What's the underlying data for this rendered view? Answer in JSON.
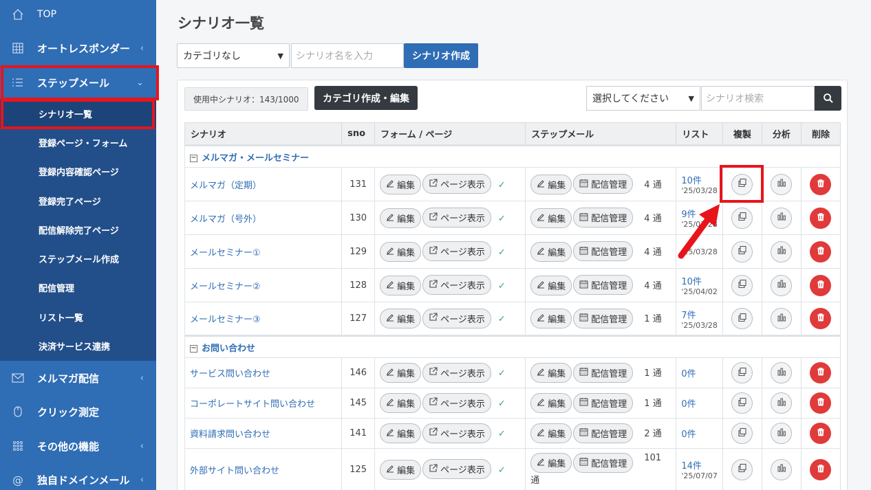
{
  "sidebar": {
    "items": [
      {
        "label": "TOP",
        "icon": "home-icon",
        "chevron": ""
      },
      {
        "label": "オートレスポンダー",
        "icon": "grid-icon",
        "chevron": "‹"
      },
      {
        "label": "ステップメール",
        "icon": "list-icon",
        "chevron": "⌄"
      },
      {
        "label": "メルマガ配信",
        "icon": "envelope-icon",
        "chevron": "‹"
      },
      {
        "label": "クリック測定",
        "icon": "mouse-icon",
        "chevron": ""
      },
      {
        "label": "その他の機能",
        "icon": "dots-grid-icon",
        "chevron": "‹"
      },
      {
        "label": "独自ドメインメール",
        "icon": "at-icon",
        "chevron": "‹"
      }
    ],
    "submenu": [
      "シナリオ一覧",
      "登録ページ・フォーム",
      "登録内容確認ページ",
      "登録完了ページ",
      "配信解除完了ページ",
      "ステップメール作成",
      "配信管理",
      "リスト一覧",
      "決済サービス連携"
    ],
    "active_submenu": "シナリオ一覧"
  },
  "main": {
    "title": "シナリオ一覧",
    "category_select": "カテゴリなし",
    "scenario_name_placeholder": "シナリオ名を入力",
    "create_button": "シナリオ作成",
    "usage": "使用中シナリオ：143/1000",
    "category_edit_button": "カテゴリ作成・編集",
    "search_select": "選択してください",
    "search_placeholder": "シナリオ検索"
  },
  "table": {
    "headers": [
      "シナリオ",
      "sno",
      "フォーム / ページ",
      "ステップメール",
      "リスト",
      "複製",
      "分析",
      "削除"
    ],
    "edit_label": "編集",
    "page_view_label": "ページ表示",
    "delivery_label": "配信管理",
    "check": "✓",
    "groups": [
      {
        "name": "メルマガ・メールセミナー",
        "rows": [
          {
            "name": "メルマガ（定期）",
            "sno": "131",
            "count": "4 通",
            "list": "10件",
            "date": "'25/03/28"
          },
          {
            "name": "メルマガ（号外）",
            "sno": "130",
            "count": "4 通",
            "list": "9件",
            "date": "'25/03/28"
          },
          {
            "name": "メールセミナー①",
            "sno": "129",
            "count": "4 通",
            "list": "",
            "date": "'25/03/28"
          },
          {
            "name": "メールセミナー②",
            "sno": "128",
            "count": "4 通",
            "list": "10件",
            "date": "'25/04/02"
          },
          {
            "name": "メールセミナー③",
            "sno": "127",
            "count": "1 通",
            "list": "7件",
            "date": "'25/03/28"
          }
        ]
      },
      {
        "name": "お問い合わせ",
        "rows": [
          {
            "name": "サービス問い合わせ",
            "sno": "146",
            "count": "1 通",
            "list": "0件",
            "date": ""
          },
          {
            "name": "コーポレートサイト問い合わせ",
            "sno": "145",
            "count": "1 通",
            "list": "0件",
            "date": ""
          },
          {
            "name": "資料請求問い合わせ",
            "sno": "141",
            "count": "2 通",
            "list": "0件",
            "date": ""
          },
          {
            "name": "外部サイト問い合わせ",
            "sno": "125",
            "count": "101",
            "count_suffix": "通",
            "list": "14件",
            "date": "'25/07/07"
          }
        ]
      }
    ]
  },
  "colors": {
    "sidebar": "#2f6db5",
    "submenu": "#224f8a",
    "highlight": "#e8141c",
    "delete": "#e03a3a"
  }
}
